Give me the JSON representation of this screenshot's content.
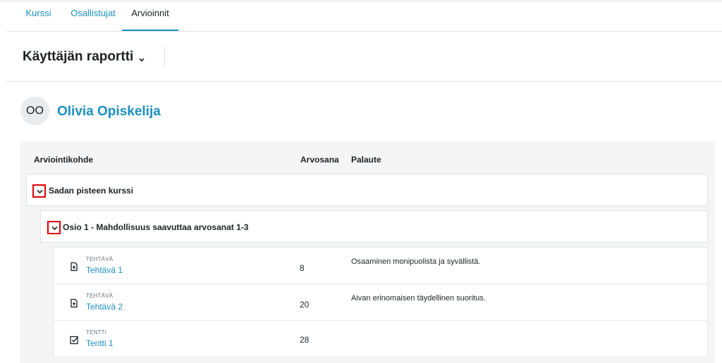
{
  "nav": {
    "tabs": [
      {
        "label": "Kurssi"
      },
      {
        "label": "Osallistujat"
      },
      {
        "label": "Arvioinnit"
      }
    ]
  },
  "report": {
    "title": "Käyttäjän raportti"
  },
  "user": {
    "initials": "OO",
    "name": "Olivia Opiskelija"
  },
  "table": {
    "headers": {
      "item": "Arviointikohde",
      "grade": "Arvosana",
      "feedback": "Palaute"
    },
    "categories": [
      {
        "label": "Sadan pisteen kurssi"
      },
      {
        "label": "Osio 1 - Mahdollisuus saavuttaa arvosanat 1-3"
      }
    ],
    "items": [
      {
        "type": "TEHTÄVÄ",
        "name": "Tehtävä 1",
        "icon": "assignment-icon",
        "grade": "8",
        "feedback": "Osaaminen monipuolista ja syvällistä."
      },
      {
        "type": "TEHTÄVÄ",
        "name": "Tehtävä 2",
        "icon": "assignment-icon",
        "grade": "20",
        "feedback": "Aivan erinomaisen täydellinen suoritus."
      },
      {
        "type": "TENTTI",
        "name": "Tentti 1",
        "icon": "quiz-icon",
        "grade": "28",
        "feedback": ""
      }
    ]
  },
  "colors": {
    "link": "#1a8fc2",
    "highlight": "#e00000"
  }
}
